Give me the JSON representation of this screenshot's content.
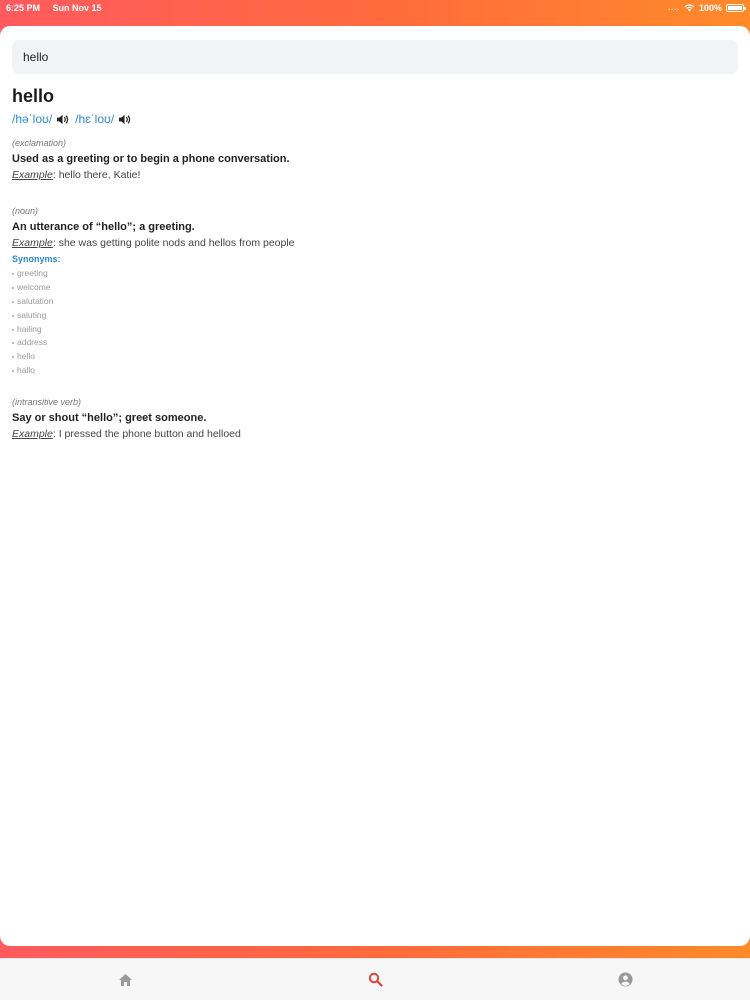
{
  "status_bar": {
    "time": "6:25 PM",
    "date": "Sun Nov 15",
    "battery": "100%",
    "wifi_icon": "wifi-icon",
    "battery_level": 1.0
  },
  "search": {
    "value": "hello",
    "placeholder": ""
  },
  "entry": {
    "word": "hello",
    "phonetics": [
      {
        "text": "/həˈloʊ/",
        "icon": "speaker-icon"
      },
      {
        "text": "/hɛˈloʊ/",
        "icon": "speaker-icon"
      }
    ],
    "meanings": [
      {
        "pos": "(exclamation)",
        "definition": "Used as a greeting or to begin a phone conversation.",
        "example_label": "Example",
        "example": ": hello there, Katie!",
        "synonyms_label": "",
        "synonyms": []
      },
      {
        "pos": "(noun)",
        "definition": "An utterance of “hello”; a greeting.",
        "example_label": "Example",
        "example": ": she was getting polite nods and hellos from people",
        "synonyms_label": "Synonyms:",
        "synonyms": [
          "greeting",
          "welcome",
          "salutation",
          "saluting",
          "hailing",
          "address",
          "hello",
          "hallo"
        ]
      },
      {
        "pos": "(intransitive verb)",
        "definition": "Say or shout “hello”; greet someone.",
        "example_label": "Example",
        "example": ": I pressed the phone button and helloed",
        "synonyms_label": "",
        "synonyms": []
      }
    ]
  },
  "tab_bar": {
    "tabs": [
      {
        "icon": "home-icon",
        "active": false
      },
      {
        "icon": "search-icon",
        "active": true
      },
      {
        "icon": "account-icon",
        "active": false
      }
    ],
    "active_color": "#e0433c",
    "inactive_color": "#9a9a9a"
  }
}
